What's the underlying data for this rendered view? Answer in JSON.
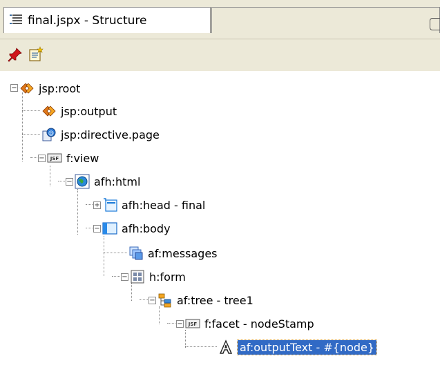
{
  "tab": {
    "title": "final.jspx - Structure",
    "icon": "structure-icon"
  },
  "toolbar": {
    "buttons": [
      {
        "icon": "pin-icon"
      },
      {
        "icon": "new-view-icon"
      }
    ]
  },
  "tree": {
    "nodes": [
      {
        "label": "jsp:root",
        "icon": "xml-tag-icon"
      },
      {
        "label": "jsp:output",
        "icon": "xml-tag-icon"
      },
      {
        "label": "jsp:directive.page",
        "icon": "page-directive-icon"
      },
      {
        "label": "f:view",
        "icon": "jsf-icon"
      },
      {
        "label": "afh:html",
        "icon": "globe-icon"
      },
      {
        "label": "afh:head - final",
        "icon": "head-icon"
      },
      {
        "label": "afh:body",
        "icon": "body-icon"
      },
      {
        "label": "af:messages",
        "icon": "messages-icon"
      },
      {
        "label": "h:form",
        "icon": "form-icon"
      },
      {
        "label": "af:tree - tree1",
        "icon": "tree-component-icon"
      },
      {
        "label": "f:facet - nodeStamp",
        "icon": "jsf-icon"
      },
      {
        "label": "af:outputText - #{node}",
        "icon": "output-text-icon",
        "selected": true
      }
    ]
  },
  "colors": {
    "selection": "#316ac5",
    "tab_bg": "#ece9d8"
  }
}
